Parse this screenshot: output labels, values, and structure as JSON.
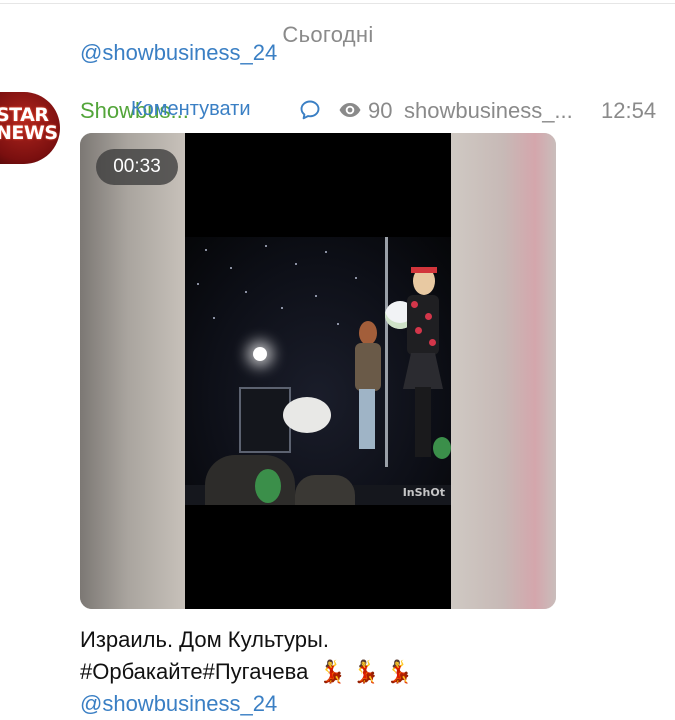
{
  "feed": {
    "previous_link": "@showbusiness_24",
    "date_separator": "Сьогодні"
  },
  "post": {
    "avatar_text": "STAR NEWS",
    "author": "Showbus...",
    "comment_label": "Коментувати",
    "views": "90",
    "signature": "showbusiness_...",
    "time": "12:54",
    "video": {
      "duration": "00:33",
      "watermark": "InShOt"
    },
    "caption": {
      "line1": "Израиль. Дом Культуры.",
      "line2": "#Орбакайте#Пугачева",
      "emojis": "💃 💃 💃",
      "link": "@showbusiness_24"
    }
  },
  "colors": {
    "link": "#3a7fc4",
    "author": "#53a53a",
    "muted": "#8a8a8a"
  }
}
